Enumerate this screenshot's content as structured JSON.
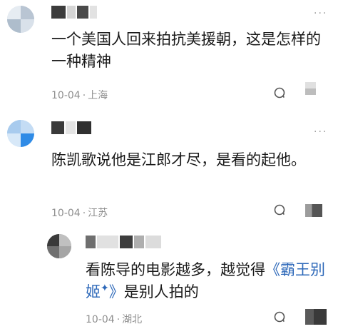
{
  "comments": [
    {
      "content": "一个美国人回来拍抗美援朝，这是怎样的一种精神",
      "date": "10-04",
      "location": "上海"
    },
    {
      "content": "陈凯歌说他是江郎才尽，是看的起他。",
      "date": "10-04",
      "location": "江苏"
    },
    {
      "content_before": "看陈导的电影越多，越觉得",
      "link_open": "《",
      "link_text": "霸王别姬",
      "link_sup": "✦",
      "link_close": "》",
      "content_after": "是别人拍的",
      "date": "10-04",
      "location": "湖北"
    }
  ],
  "more_label": "···",
  "meta_separator": "·",
  "colors": {
    "text": "#1a1a1a",
    "meta": "#8f8f8f",
    "link": "#2d68b9",
    "icon": "#9a9a9a"
  },
  "icons": {
    "reply": "reply-bubble-icon",
    "more": "more-dots-icon"
  }
}
